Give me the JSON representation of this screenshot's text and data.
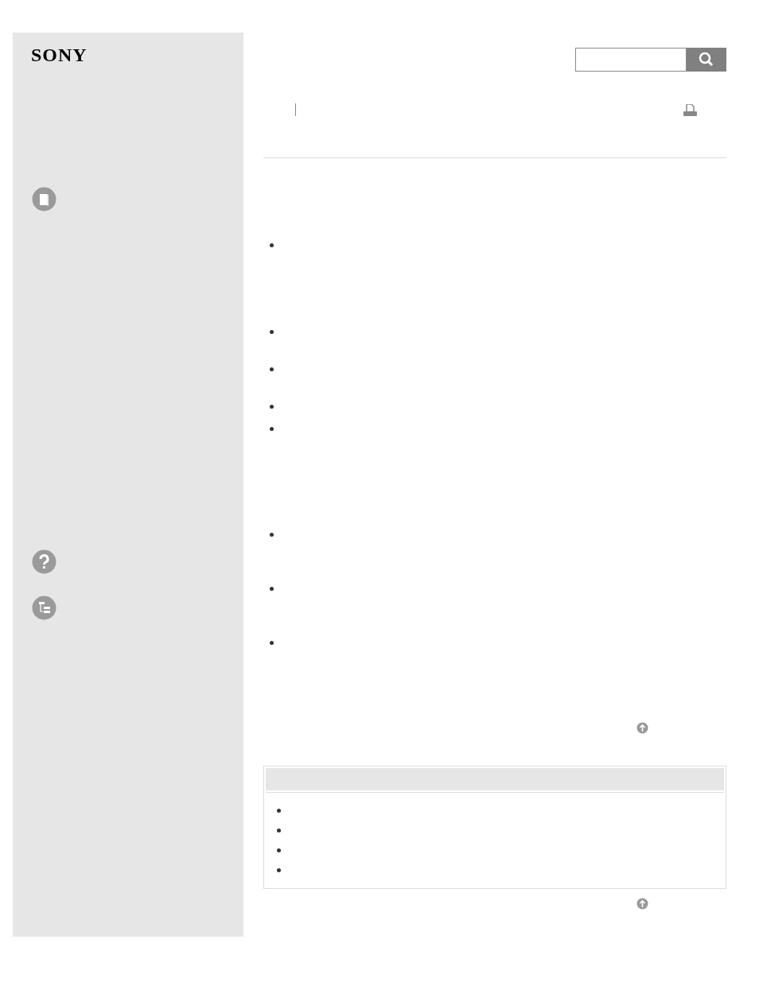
{
  "header": {
    "logo": "SONY"
  }
}
